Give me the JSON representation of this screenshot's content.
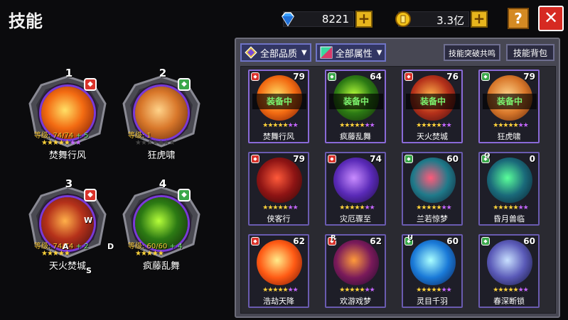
{
  "title": "技能",
  "currency": {
    "diamond": "8221",
    "gold": "3.3亿"
  },
  "buttons": {
    "help": "?",
    "close": "✕",
    "plus": "+"
  },
  "equipped": [
    {
      "slot": "1",
      "name": "焚舞行风",
      "level_label": "等级: 74/74",
      "bonus": "+ 5",
      "element": "fire",
      "stars_gold": 5,
      "stars_purple": 2,
      "stars_empty": 0,
      "orb": [
        "#ffe066",
        "#f36b12",
        "#6b1206"
      ]
    },
    {
      "slot": "2",
      "name": "狂虎啸",
      "level_label": "等级: 1",
      "bonus": "",
      "element": "wood",
      "stars_gold": 0,
      "stars_purple": 0,
      "stars_empty": 7,
      "orb": [
        "#ffd38a",
        "#d9782b",
        "#5c2208"
      ]
    },
    {
      "slot": "3",
      "name": "天火焚城",
      "level_label": "等级: 74/74",
      "bonus": "+ 2",
      "element": "fire",
      "stars_gold": 5,
      "stars_purple": 0,
      "stars_empty": 0,
      "orb": [
        "#ffb04a",
        "#b5311a",
        "#3a0b12"
      ]
    },
    {
      "slot": "4",
      "name": "疯藤乱舞",
      "level_label": "等级: 60/60",
      "bonus": "+ 4",
      "element": "wood",
      "stars_gold": 5,
      "stars_purple": 0,
      "stars_empty": 0,
      "orb": [
        "#b6ff3a",
        "#2c7a14",
        "#10200a"
      ]
    }
  ],
  "hints": {
    "w": "W",
    "a": "A",
    "s": "S",
    "d": "D"
  },
  "filters": {
    "quality": "全部品质",
    "attribute": "全部属性",
    "breakthrough": "技能突破共鸣",
    "backpack": "技能背包"
  },
  "cards": [
    {
      "name": "焚舞行风",
      "level": "79",
      "equipped": "装备中",
      "element": "fire",
      "hotkey": "",
      "orb": [
        "#ffe066",
        "#f36b12",
        "#6b1206"
      ]
    },
    {
      "name": "疯藤乱舞",
      "level": "64",
      "equipped": "装备中",
      "element": "wood",
      "hotkey": "",
      "orb": [
        "#b6ff3a",
        "#2c7a14",
        "#10200a"
      ]
    },
    {
      "name": "天火焚城",
      "level": "76",
      "equipped": "装备中",
      "element": "fire",
      "hotkey": "",
      "orb": [
        "#ffb04a",
        "#b5311a",
        "#3a0b12"
      ]
    },
    {
      "name": "狂虎啸",
      "level": "79",
      "equipped": "装备中",
      "element": "wood",
      "hotkey": "",
      "orb": [
        "#ffd38a",
        "#d9782b",
        "#5c2208"
      ]
    },
    {
      "name": "侠客行",
      "level": "79",
      "equipped": "",
      "element": "fire",
      "hotkey": "",
      "orb": [
        "#ff5a3a",
        "#8e1414",
        "#2a0808"
      ]
    },
    {
      "name": "灾厄骤至",
      "level": "74",
      "equipped": "",
      "element": "fire",
      "hotkey": "",
      "orb": [
        "#c98cff",
        "#5a2ab8",
        "#1a0a3a"
      ]
    },
    {
      "name": "兰若惊梦",
      "level": "60",
      "equipped": "",
      "element": "wood",
      "hotkey": "",
      "orb": [
        "#ff5a7a",
        "#1f7a8a",
        "#101c30"
      ]
    },
    {
      "name": "昏月兽临",
      "level": "0",
      "equipped": "",
      "element": "wood",
      "hotkey": "Q",
      "orb": [
        "#5aff9a",
        "#1a6a7a",
        "#0a1a2a"
      ]
    },
    {
      "name": "浩劫天降",
      "level": "62",
      "equipped": "",
      "element": "fire",
      "hotkey": "",
      "orb": [
        "#ffec8a",
        "#ff5a14",
        "#6a1206"
      ]
    },
    {
      "name": "欢游戏梦",
      "level": "62",
      "equipped": "",
      "element": "fire",
      "hotkey": "R",
      "orb": [
        "#ff9a3a",
        "#7a1a5a",
        "#1a0a2a"
      ]
    },
    {
      "name": "灵目千羽",
      "level": "60",
      "equipped": "",
      "element": "wood",
      "hotkey": "U",
      "orb": [
        "#aaffff",
        "#1a7ad8",
        "#0a1a4a"
      ]
    },
    {
      "name": "春深断锁",
      "level": "60",
      "equipped": "",
      "element": "wood",
      "hotkey": "",
      "orb": [
        "#c8e0ff",
        "#5a5ab8",
        "#101030"
      ]
    }
  ],
  "colors": {
    "fire": "#d9332b",
    "wood": "#3aa84a",
    "equipped_text": "#7bf26e",
    "star": "#ffd23a",
    "star_purple": "#c466ff"
  }
}
